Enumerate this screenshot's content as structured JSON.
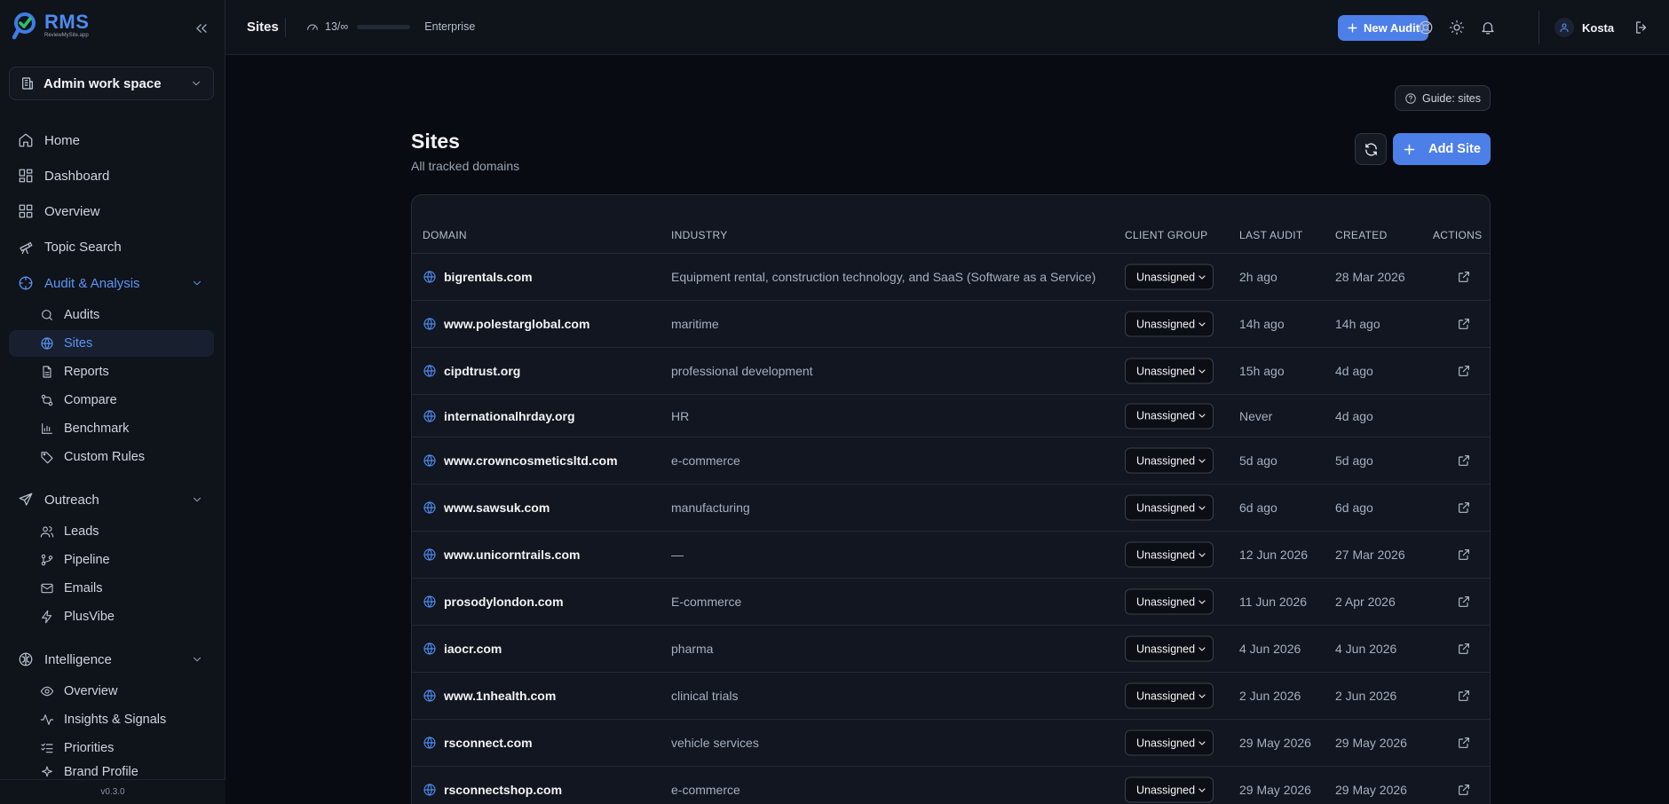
{
  "brand": {
    "name": "RMS",
    "sub": "ReviewMySite.app"
  },
  "sidebar": {
    "workspace": "Admin work space",
    "top": [
      {
        "label": "Home",
        "icon": "home-icon"
      },
      {
        "label": "Dashboard",
        "icon": "dashboard-icon"
      },
      {
        "label": "Overview",
        "icon": "grid-icon"
      },
      {
        "label": "Topic Search",
        "icon": "telescope-icon"
      }
    ],
    "sections": [
      {
        "label": "Audit & Analysis",
        "icon": "crosshair-icon",
        "open": true,
        "items": [
          {
            "label": "Audits",
            "icon": "search-icon"
          },
          {
            "label": "Sites",
            "icon": "globe-icon",
            "active": true
          },
          {
            "label": "Reports",
            "icon": "file-icon"
          },
          {
            "label": "Compare",
            "icon": "compare-icon"
          },
          {
            "label": "Benchmark",
            "icon": "bar-chart-icon"
          },
          {
            "label": "Custom Rules",
            "icon": "tag-icon"
          }
        ]
      },
      {
        "label": "Outreach",
        "icon": "send-icon",
        "open": false,
        "items": [
          {
            "label": "Leads",
            "icon": "users-icon"
          },
          {
            "label": "Pipeline",
            "icon": "git-branch-icon"
          },
          {
            "label": "Emails",
            "icon": "mail-icon"
          },
          {
            "label": "PlusVibe",
            "icon": "zap-icon"
          }
        ]
      },
      {
        "label": "Intelligence",
        "icon": "brain-icon",
        "open": false,
        "items": [
          {
            "label": "Overview",
            "icon": "eye-icon"
          },
          {
            "label": "Insights & Signals",
            "icon": "activity-icon"
          },
          {
            "label": "Priorities",
            "icon": "list-checks-icon"
          },
          {
            "label": "Brand Profile",
            "icon": "sparkle-icon"
          }
        ]
      }
    ],
    "version": "v0.3.0"
  },
  "topbar": {
    "title": "Sites",
    "usage": "13/∞",
    "usage_fraction": 0,
    "plan": "Enterprise",
    "new_audit": "New Audit",
    "user": "Kosta"
  },
  "page": {
    "guide": "Guide: sites",
    "title": "Sites",
    "subtitle": "All tracked domains",
    "add_site": "Add Site"
  },
  "table": {
    "columns": [
      "Domain",
      "Industry",
      "Client Group",
      "Last Audit",
      "Created",
      "Actions"
    ],
    "rows": [
      {
        "domain": "bigrentals.com",
        "industry": "Equipment rental, construction technology, and SaaS (Software as a Service)",
        "group": "Unassigned",
        "last": "2h ago",
        "created": "28 Mar 2026",
        "action": true
      },
      {
        "domain": "www.polestarglobal.com",
        "industry": "maritime",
        "group": "Unassigned",
        "last": "14h ago",
        "created": "14h ago",
        "action": true
      },
      {
        "domain": "cipdtrust.org",
        "industry": "professional development",
        "group": "Unassigned",
        "last": "15h ago",
        "created": "4d ago",
        "action": true
      },
      {
        "domain": "internationalhrday.org",
        "industry": "HR",
        "group": "Unassigned",
        "last": "Never",
        "created": "4d ago",
        "action": false
      },
      {
        "domain": "www.crowncosmeticsltd.com",
        "industry": "e-commerce",
        "group": "Unassigned",
        "last": "5d ago",
        "created": "5d ago",
        "action": true
      },
      {
        "domain": "www.sawsuk.com",
        "industry": "manufacturing",
        "group": "Unassigned",
        "last": "6d ago",
        "created": "6d ago",
        "action": true
      },
      {
        "domain": "www.unicorntrails.com",
        "industry": "—",
        "group": "Unassigned",
        "last": "12 Jun 2026",
        "created": "27 Mar 2026",
        "action": true
      },
      {
        "domain": "prosodylondon.com",
        "industry": "E-commerce",
        "group": "Unassigned",
        "last": "11 Jun 2026",
        "created": "2 Apr 2026",
        "action": true
      },
      {
        "domain": "iaocr.com",
        "industry": "pharma",
        "group": "Unassigned",
        "last": "4 Jun 2026",
        "created": "4 Jun 2026",
        "action": true
      },
      {
        "domain": "www.1nhealth.com",
        "industry": "clinical trials",
        "group": "Unassigned",
        "last": "2 Jun 2026",
        "created": "2 Jun 2026",
        "action": true
      },
      {
        "domain": "rsconnect.com",
        "industry": "vehicle services",
        "group": "Unassigned",
        "last": "29 May 2026",
        "created": "29 May 2026",
        "action": true
      },
      {
        "domain": "rsconnectshop.com",
        "industry": "e-commerce",
        "group": "Unassigned",
        "last": "29 May 2026",
        "created": "29 May 2026",
        "action": true
      }
    ]
  }
}
